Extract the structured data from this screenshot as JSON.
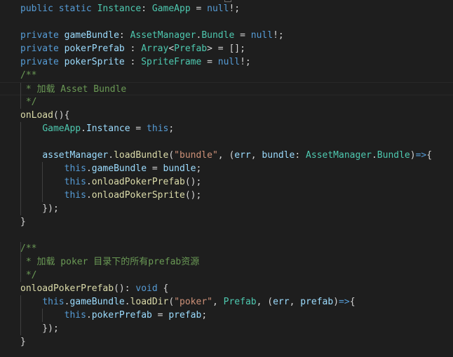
{
  "editor": {
    "lines": [
      [
        [
          "kw",
          "public"
        ],
        [
          "pl",
          " "
        ],
        [
          "kw",
          "static"
        ],
        [
          "pl",
          " "
        ],
        [
          "ty",
          "Instance"
        ],
        [
          "pl",
          ": "
        ],
        [
          "ty",
          "GameApp"
        ],
        [
          "pl",
          " = "
        ],
        [
          "kw",
          "null"
        ],
        [
          "pl",
          "!;"
        ]
      ],
      [],
      [
        [
          "kw",
          "private"
        ],
        [
          "pl",
          " "
        ],
        [
          "var",
          "gameBundle"
        ],
        [
          "pl",
          ": "
        ],
        [
          "ty",
          "AssetManager"
        ],
        [
          "pl",
          "."
        ],
        [
          "ty",
          "Bundle"
        ],
        [
          "pl",
          " = "
        ],
        [
          "kw",
          "null"
        ],
        [
          "pl",
          "!;"
        ]
      ],
      [
        [
          "kw",
          "private"
        ],
        [
          "pl",
          " "
        ],
        [
          "var",
          "pokerPrefab"
        ],
        [
          "pl",
          " : "
        ],
        [
          "ty",
          "Array"
        ],
        [
          "pl",
          "<"
        ],
        [
          "ty",
          "Prefab"
        ],
        [
          "pl",
          "> = [];"
        ]
      ],
      [
        [
          "kw",
          "private"
        ],
        [
          "pl",
          " "
        ],
        [
          "var",
          "pokerSprite"
        ],
        [
          "pl",
          " : "
        ],
        [
          "ty",
          "SpriteFrame"
        ],
        [
          "pl",
          " = "
        ],
        [
          "kw",
          "null"
        ],
        [
          "pl",
          "!;"
        ]
      ],
      [
        [
          "cm",
          "/**"
        ]
      ],
      [
        [
          "cm",
          " * 加载 Asset Bundle"
        ]
      ],
      [
        [
          "cm",
          " */"
        ]
      ],
      [
        [
          "fn",
          "onLoad"
        ],
        [
          "pl",
          "(){"
        ]
      ],
      [
        [
          "pl",
          "    "
        ],
        [
          "ty",
          "GameApp"
        ],
        [
          "pl",
          "."
        ],
        [
          "var",
          "Instance"
        ],
        [
          "pl",
          " = "
        ],
        [
          "kw",
          "this"
        ],
        [
          "pl",
          ";"
        ]
      ],
      [],
      [
        [
          "pl",
          "    "
        ],
        [
          "var",
          "assetManager"
        ],
        [
          "pl",
          "."
        ],
        [
          "fn",
          "loadBundle"
        ],
        [
          "pl",
          "("
        ],
        [
          "str",
          "\"bundle\""
        ],
        [
          "pl",
          ", ("
        ],
        [
          "var",
          "err"
        ],
        [
          "pl",
          ", "
        ],
        [
          "var",
          "bundle"
        ],
        [
          "pl",
          ": "
        ],
        [
          "ty",
          "AssetManager"
        ],
        [
          "pl",
          "."
        ],
        [
          "ty",
          "Bundle"
        ],
        [
          "pl",
          ")"
        ],
        [
          "kw",
          "=>"
        ],
        [
          "pl",
          "{"
        ]
      ],
      [
        [
          "pl",
          "        "
        ],
        [
          "kw",
          "this"
        ],
        [
          "pl",
          "."
        ],
        [
          "var",
          "gameBundle"
        ],
        [
          "pl",
          " = "
        ],
        [
          "var",
          "bundle"
        ],
        [
          "pl",
          ";"
        ]
      ],
      [
        [
          "pl",
          "        "
        ],
        [
          "kw",
          "this"
        ],
        [
          "pl",
          "."
        ],
        [
          "fn",
          "onloadPokerPrefab"
        ],
        [
          "pl",
          "();"
        ]
      ],
      [
        [
          "pl",
          "        "
        ],
        [
          "kw",
          "this"
        ],
        [
          "pl",
          "."
        ],
        [
          "fn",
          "onloadPokerSprite"
        ],
        [
          "pl",
          "();"
        ]
      ],
      [
        [
          "pl",
          "    });"
        ]
      ],
      [
        [
          "pl",
          "}"
        ]
      ],
      [],
      [
        [
          "cm",
          "/**"
        ]
      ],
      [
        [
          "cm",
          " * 加载 poker 目录下的所有prefab资源"
        ]
      ],
      [
        [
          "cm",
          " */"
        ]
      ],
      [
        [
          "fn",
          "onloadPokerPrefab"
        ],
        [
          "pl",
          "(): "
        ],
        [
          "kw",
          "void"
        ],
        [
          "pl",
          " {"
        ]
      ],
      [
        [
          "pl",
          "    "
        ],
        [
          "kw",
          "this"
        ],
        [
          "pl",
          "."
        ],
        [
          "var",
          "gameBundle"
        ],
        [
          "pl",
          "."
        ],
        [
          "fn",
          "loadDir"
        ],
        [
          "pl",
          "("
        ],
        [
          "str",
          "\"poker\""
        ],
        [
          "pl",
          ", "
        ],
        [
          "ty",
          "Prefab"
        ],
        [
          "pl",
          ", ("
        ],
        [
          "var",
          "err"
        ],
        [
          "pl",
          ", "
        ],
        [
          "var",
          "prefab"
        ],
        [
          "pl",
          ")"
        ],
        [
          "kw",
          "=>"
        ],
        [
          "pl",
          "{"
        ]
      ],
      [
        [
          "pl",
          "        "
        ],
        [
          "kw",
          "this"
        ],
        [
          "pl",
          "."
        ],
        [
          "var",
          "pokerPrefab"
        ],
        [
          "pl",
          " = "
        ],
        [
          "var",
          "prefab"
        ],
        [
          "pl",
          ";"
        ]
      ],
      [
        [
          "pl",
          "    });"
        ]
      ],
      [
        [
          "pl",
          "}"
        ]
      ]
    ]
  },
  "colors": {
    "background": "#1e1e1e",
    "keyword": "#569cd6",
    "type": "#4ec9b0",
    "variable": "#9cdcfe",
    "function": "#dcdcaa",
    "string": "#ce9178",
    "comment": "#6a9955",
    "plain": "#d4d4d4"
  }
}
